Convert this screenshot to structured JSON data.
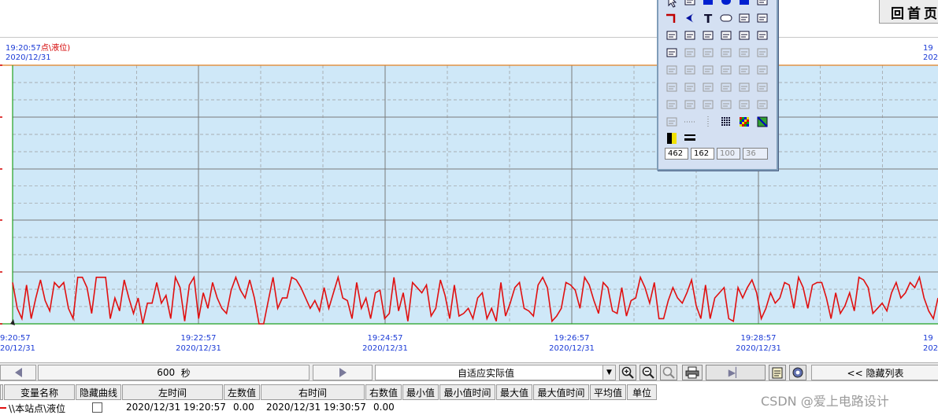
{
  "header": {
    "home_label": "回首页"
  },
  "chart_top": {
    "left_time": "19:20:57",
    "left_tag": "点\\液位)",
    "left_date": "2020/12/31",
    "right_time": "19",
    "right_date": "202"
  },
  "axis": {
    "ticks": [
      {
        "time": "9:20:57",
        "date": "20/12/31"
      },
      {
        "time": "19:22:57",
        "date": "2020/12/31"
      },
      {
        "time": "19:24:57",
        "date": "2020/12/31"
      },
      {
        "time": "19:26:57",
        "date": "2020/12/31"
      },
      {
        "time": "19:28:57",
        "date": "2020/12/31"
      },
      {
        "time": "19",
        "date": "202"
      }
    ]
  },
  "controls": {
    "span_value": "600",
    "span_unit": "秒",
    "mode_value": "自适应实际值",
    "hide_list_label": "<< 隐藏列表"
  },
  "table": {
    "headers": [
      "变量名称",
      "隐藏曲线",
      "左时间",
      "左数值",
      "右时间",
      "右数值",
      "最小值",
      "最小值时间",
      "最大值",
      "最大值时间",
      "平均值",
      "单位"
    ],
    "rows": [
      {
        "name": "\\\\本站点\\液位",
        "left_time": "2020/12/31 19:20:57",
        "left_value": "0.00",
        "right_time": "2020/12/31 19:30:57",
        "right_value": "0.00"
      }
    ]
  },
  "palette": {
    "fields": [
      "462",
      "162",
      "100",
      "36"
    ]
  },
  "watermark": "CSDN @爱上电路设计",
  "colors": {
    "plot_bg": "#cfe8f8",
    "curve": "#e01010",
    "grid_major": "#7a7a7a",
    "grid_minor": "#9a9a9a",
    "top_line": "#e08020",
    "bottom_line": "#20a020"
  },
  "chart_data": {
    "type": "line",
    "x_range": [
      "2020/12/31 19:20:57",
      "2020/12/31 19:30:57"
    ],
    "series": [
      {
        "values": [
          0.16,
          0.06,
          0.02,
          0.15,
          0.02,
          0.1,
          0.17,
          0.09,
          0.05,
          0.16,
          0.14,
          0.16,
          0.06,
          0.02,
          0.18,
          0.18,
          0.14,
          0.04,
          0.18,
          0.18,
          0.18,
          0.02,
          0.1,
          0.05,
          0.17,
          0.1,
          0.04,
          0.1,
          0.0,
          0.08,
          0.08,
          0.16,
          0.08,
          0.11,
          0.02,
          0.18,
          0.14,
          0.01,
          0.15,
          0.18,
          0.02,
          0.12,
          0.06,
          0.16,
          0.1,
          0.06,
          0.04,
          0.13,
          0.18,
          0.13,
          0.1,
          0.17,
          0.1,
          0.0,
          0.0,
          0.09,
          0.18,
          0.06,
          0.1,
          0.1,
          0.18,
          0.17,
          0.14,
          0.1,
          0.06,
          0.09,
          0.05,
          0.14,
          0.06,
          0.12,
          0.18,
          0.1,
          0.09,
          0.02,
          0.16,
          0.06,
          0.1,
          0.02,
          0.12,
          0.13,
          0.02,
          0.04,
          0.18,
          0.05,
          0.12,
          0.01,
          0.16,
          0.14,
          0.12,
          0.15,
          0.03,
          0.06,
          0.17,
          0.11,
          0.02,
          0.15,
          0.03,
          0.04,
          0.06,
          0.02,
          0.1,
          0.12,
          0.02,
          0.06,
          0.01,
          0.16,
          0.03,
          0.08,
          0.14,
          0.16,
          0.06,
          0.05,
          0.03,
          0.15,
          0.18,
          0.14,
          0.01,
          0.03,
          0.06,
          0.16,
          0.15,
          0.13,
          0.06,
          0.18,
          0.15,
          0.09,
          0.04,
          0.16,
          0.14,
          0.05,
          0.04,
          0.14,
          0.03,
          0.09,
          0.1,
          0.18,
          0.14,
          0.08,
          0.16,
          0.02,
          0.02,
          0.09,
          0.14,
          0.1,
          0.08,
          0.12,
          0.17,
          0.07,
          0.02,
          0.15,
          0.02,
          0.1,
          0.12,
          0.14,
          0.02,
          0.01,
          0.14,
          0.1,
          0.14,
          0.17,
          0.12,
          0.02,
          0.06,
          0.12,
          0.08,
          0.1,
          0.16,
          0.15,
          0.06,
          0.18,
          0.14,
          0.06,
          0.15,
          0.16,
          0.16,
          0.1,
          0.02,
          0.12,
          0.04,
          0.07,
          0.12,
          0.05,
          0.18,
          0.17,
          0.14,
          0.04,
          0.06,
          0.08,
          0.05,
          0.12,
          0.16,
          0.1,
          0.12,
          0.16,
          0.14,
          0.18,
          0.1,
          0.05,
          0.02,
          0.1
        ]
      }
    ]
  }
}
